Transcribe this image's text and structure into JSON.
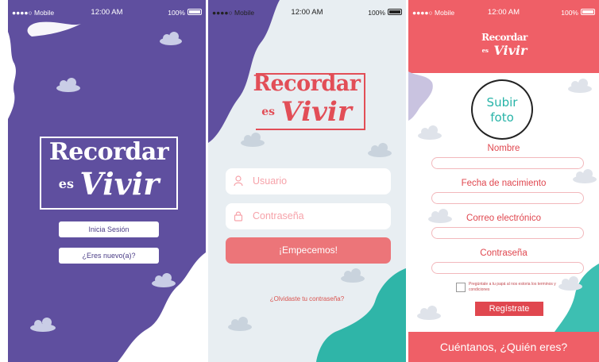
{
  "status_bar": {
    "carrier": "●●●●○ Mobile",
    "time": "12:00 AM",
    "battery": "100%"
  },
  "welcome_screen": {
    "logo_line1": "Recordar",
    "logo_line2": "es",
    "logo_line3": "Vivir",
    "login_button": "Inicia Sesión",
    "new_user_button": "¿Eres nuevo(a)?",
    "colors": {
      "background": "#5f4f9f",
      "accent": "#ffffff"
    }
  },
  "login_screen": {
    "logo_line1": "Recordar",
    "logo_line2": "es",
    "logo_line3": "Vivir",
    "username_placeholder": "Usuario",
    "password_placeholder": "Contraseña",
    "submit_button": "¡Empecemos!",
    "forgot_password_link": "¿Olvidaste tu contraseña?",
    "username_icon": "user-icon",
    "password_icon": "lock-icon",
    "colors": {
      "background": "#e8eef2",
      "accent": "#ec7579",
      "wave": "#2fb5a8"
    }
  },
  "register_screen": {
    "logo_line1": "Recordar",
    "logo_line2": "es",
    "logo_line3": "Vivir",
    "photo_line1": "Subir",
    "photo_line2": "foto",
    "name_label": "Nombre",
    "birthdate_label": "Fecha de nacimiento",
    "email_label": "Correo electrónico",
    "password_label": "Contraseña",
    "terms_text": "Pregúntale a tu papá al nos estoria los terminos y condiciones",
    "register_button": "Regístrate",
    "footer_text": "Cuéntanos, ¿Quién eres?",
    "colors": {
      "header": "#ef5f67",
      "accent": "#e0474f",
      "photo_text": "#27b3a7"
    }
  }
}
